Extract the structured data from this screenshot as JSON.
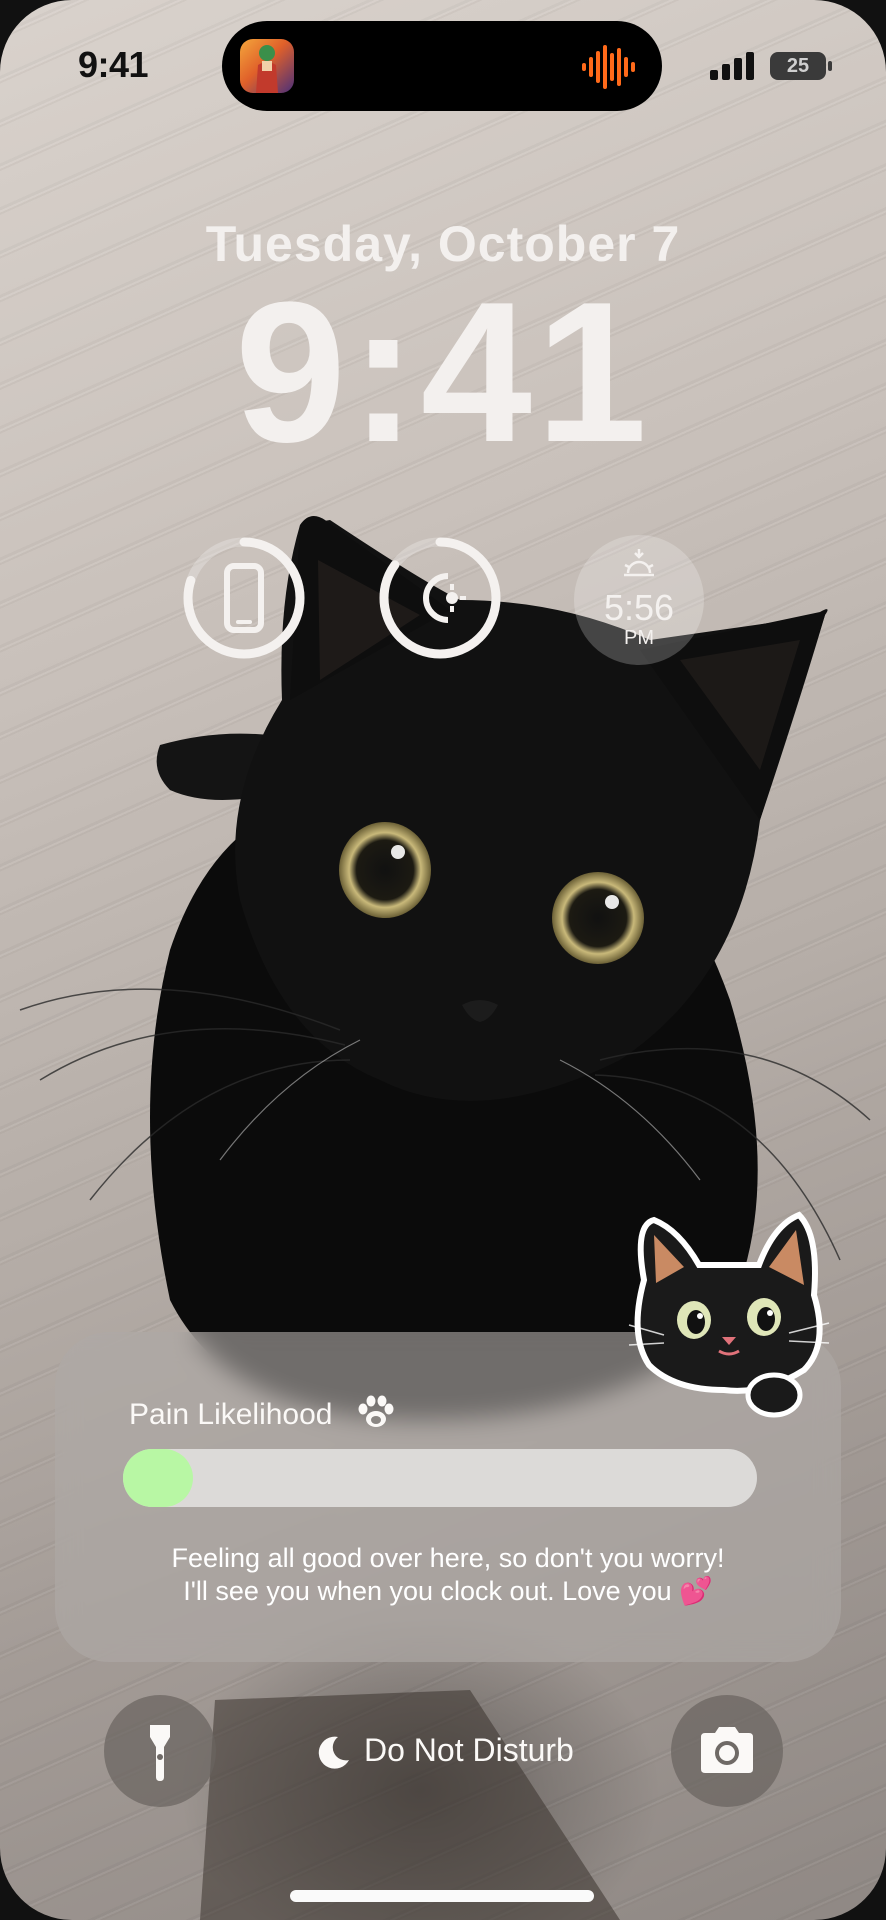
{
  "status_bar": {
    "time": "9:41",
    "battery_level": "25",
    "signal_bars": 4,
    "live_activity": {
      "app_icon": "app-icon",
      "indicator": "audio-waveform-icon",
      "indicator_color": "#ff6a1a"
    }
  },
  "lock_screen": {
    "date": "Tuesday, October 7",
    "time": "9:41"
  },
  "widgets": {
    "phone_battery_ring": {
      "icon": "iphone-icon",
      "level": 0.8
    },
    "brightness_ring": {
      "icon": "sun-moon-icon",
      "level": 0.85
    },
    "sunset": {
      "icon": "sunset-icon",
      "time": "5:56",
      "period": "PM"
    }
  },
  "notification_card": {
    "title": "Pain Likelihood",
    "title_icon": "paw-icon",
    "progress": 0.11,
    "progress_color": "#b8f7a4",
    "message_line1": "Feeling all good over here, so don't you worry!",
    "message_line2": "I'll see you when you clock out. Love you 💕",
    "sticker": "black-cat-sticker"
  },
  "bottom_controls": {
    "flashlight_icon": "flashlight-icon",
    "focus_icon": "moon-icon",
    "focus_label": "Do Not Disturb",
    "camera_icon": "camera-icon"
  }
}
